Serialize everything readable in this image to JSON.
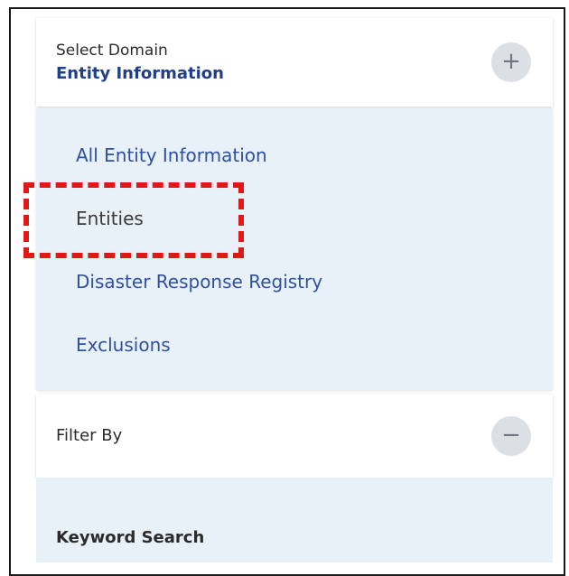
{
  "domain_selector": {
    "label": "Select Domain",
    "value": "Entity Information",
    "expand_symbol": "+"
  },
  "entity_links": [
    {
      "label": "All Entity Information",
      "selected": false
    },
    {
      "label": "Entities",
      "selected": true
    },
    {
      "label": "Disaster Response Registry",
      "selected": false
    },
    {
      "label": "Exclusions",
      "selected": false
    }
  ],
  "filter": {
    "label": "Filter By",
    "collapse_symbol": "−"
  },
  "keyword_search": {
    "label": "Keyword Search"
  },
  "colors": {
    "link": "#2f4fa4",
    "selected_text": "#3a3a3a",
    "domain_value": "#1f3f8a",
    "panel_bg": "#e9f1f8",
    "highlight": "#e01818"
  }
}
